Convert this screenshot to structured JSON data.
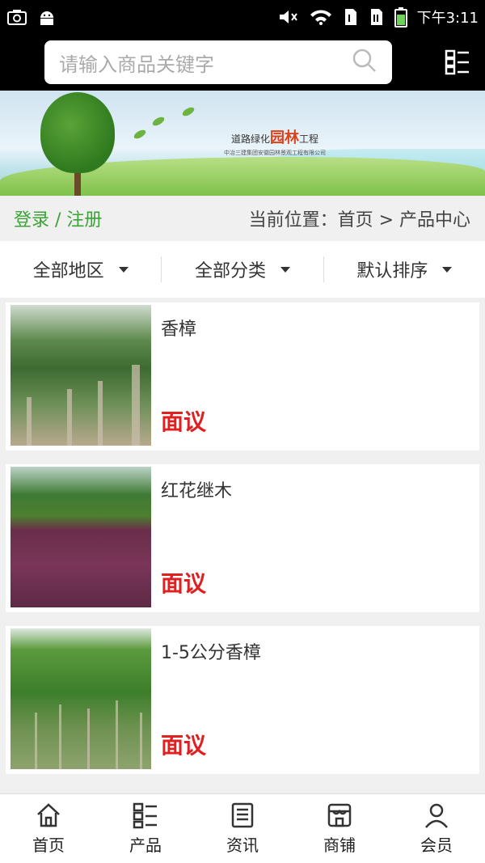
{
  "status_bar": {
    "time": "下午3:11",
    "icons": [
      "screenshot-icon",
      "android-icon",
      "mute-icon",
      "wifi-icon",
      "sim1-icon",
      "sim2-icon",
      "battery-icon"
    ]
  },
  "header": {
    "search_placeholder": "请输入商品关键字",
    "menu_icon": "grid-menu-icon"
  },
  "banner": {
    "title_prefix": "道路绿化",
    "title_accent": "园林",
    "title_suffix": "工程",
    "subtitle": "中冶三建集团安徽园林景观工程有限公司"
  },
  "nav_row": {
    "login_label": "登录 / 注册",
    "breadcrumb": "当前位置：首页 > 产品中心"
  },
  "filters": [
    {
      "label": "全部地区"
    },
    {
      "label": "全部分类"
    },
    {
      "label": "默认排序"
    }
  ],
  "products": [
    {
      "name": "香樟",
      "price": "面议"
    },
    {
      "name": "红花继木",
      "price": "面议"
    },
    {
      "name": "1-5公分香樟",
      "price": "面议"
    }
  ],
  "bottom_nav": [
    {
      "label": "首页",
      "icon": "home-icon"
    },
    {
      "label": "产品",
      "icon": "grid-list-icon"
    },
    {
      "label": "资讯",
      "icon": "news-icon"
    },
    {
      "label": "商铺",
      "icon": "store-icon"
    },
    {
      "label": "会员",
      "icon": "user-icon"
    }
  ],
  "colors": {
    "accent_green": "#3aa335",
    "price_red": "#e02020"
  }
}
